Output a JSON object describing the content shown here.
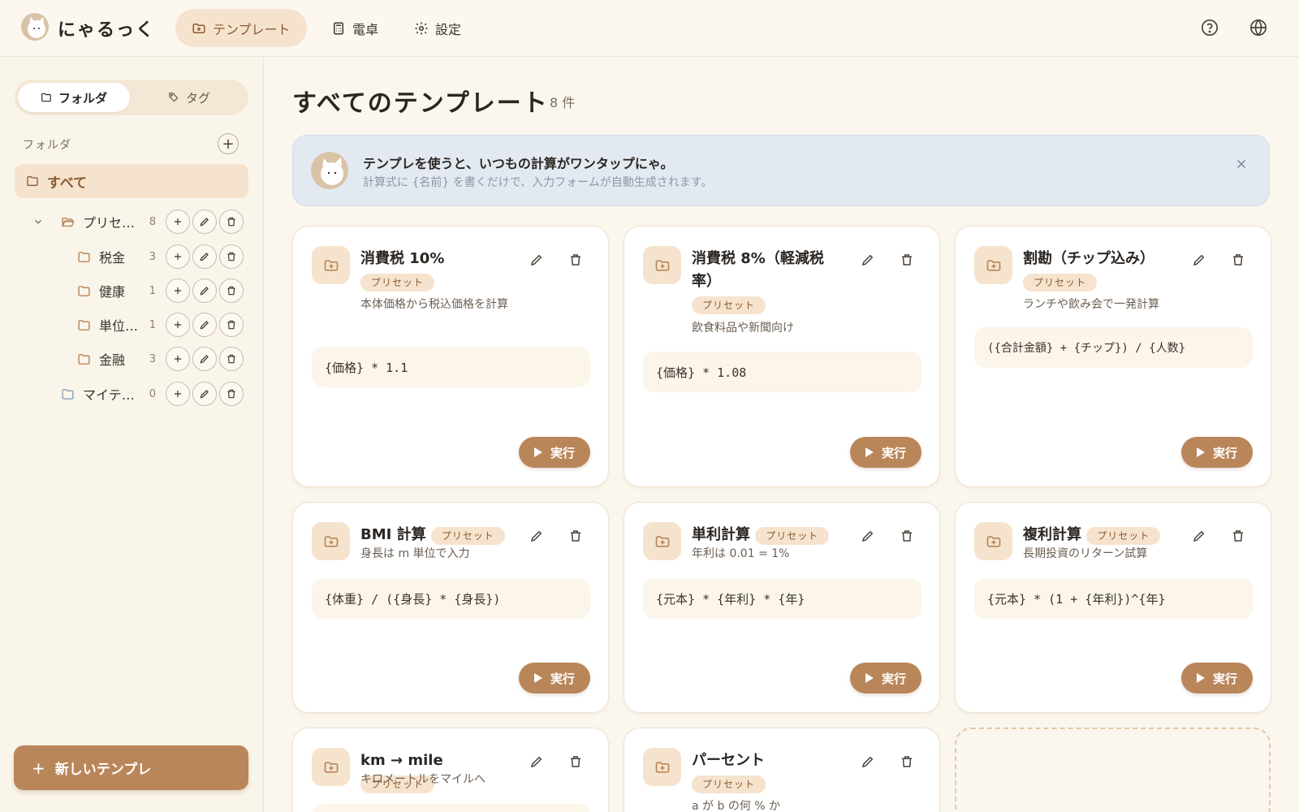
{
  "header": {
    "app_title": "にゃるっく",
    "tabs": [
      {
        "label": "テンプレート",
        "icon": "template-icon",
        "active": true
      },
      {
        "label": "電卓",
        "icon": "calculator-icon",
        "active": false
      },
      {
        "label": "設定",
        "icon": "gear-icon",
        "active": false
      }
    ],
    "help_icon": "help-icon",
    "language_icon": "globe-icon"
  },
  "sidebar": {
    "segments": [
      {
        "label": "フォルダ",
        "icon": "folder-icon",
        "active": true
      },
      {
        "label": "タグ",
        "icon": "tag-icon",
        "active": false
      }
    ],
    "section_label": "フォルダ",
    "all_label": "すべて",
    "tree": [
      {
        "label": "プリセット",
        "count": "8",
        "expanded": true
      },
      {
        "label": "税金",
        "count": "3"
      },
      {
        "label": "健康",
        "count": "1"
      },
      {
        "label": "単位変換",
        "count": "1"
      },
      {
        "label": "金融",
        "count": "3"
      },
      {
        "label": "マイテンプレート",
        "count": "0"
      }
    ],
    "new_button": "新しいテンプレ"
  },
  "main": {
    "title": "すべてのテンプレート",
    "count": "8 件",
    "banner": {
      "title": "テンプレを使うと、いつもの計算がワンタップにゃ。",
      "subtitle": "計算式に {名前} を書くだけで、入力フォームが自動生成されます。"
    },
    "cards": [
      {
        "title": "消費税 10%",
        "badge": "プリセット",
        "desc": "本体価格から税込価格を計算",
        "formula": "{価格} * 1.1",
        "run": "実行"
      },
      {
        "title": "消費税 8%（軽減税率）",
        "badge": "プリセット",
        "desc": "飲食料品や新聞向け",
        "formula": "{価格} * 1.08",
        "run": "実行"
      },
      {
        "title": "割勘（チップ込み）",
        "badge": "プリセット",
        "desc": "ランチや飲み会で一発計算",
        "formula": "({合計金額} + {チップ}) / {人数}",
        "run": "実行"
      },
      {
        "title": "BMI 計算",
        "badge": "プリセット",
        "desc": "身長は m 単位で入力",
        "formula": "{体重} / ({身長} * {身長})",
        "run": "実行"
      },
      {
        "title": "単利計算",
        "badge": "プリセット",
        "desc": "年利は 0.01 = 1%",
        "formula": "{元本} * {年利} * {年}",
        "run": "実行"
      },
      {
        "title": "複利計算",
        "badge": "プリセット",
        "desc": "長期投資のリターン試算",
        "formula": "{元本} * (1 + {年利})^{年}",
        "run": "実行"
      },
      {
        "title": "km → mile",
        "badge": "プリセット",
        "desc": "キロメートルをマイルへ"
      },
      {
        "title": "パーセント",
        "badge": "プリセット",
        "desc": "a が b の何 % か"
      }
    ]
  }
}
